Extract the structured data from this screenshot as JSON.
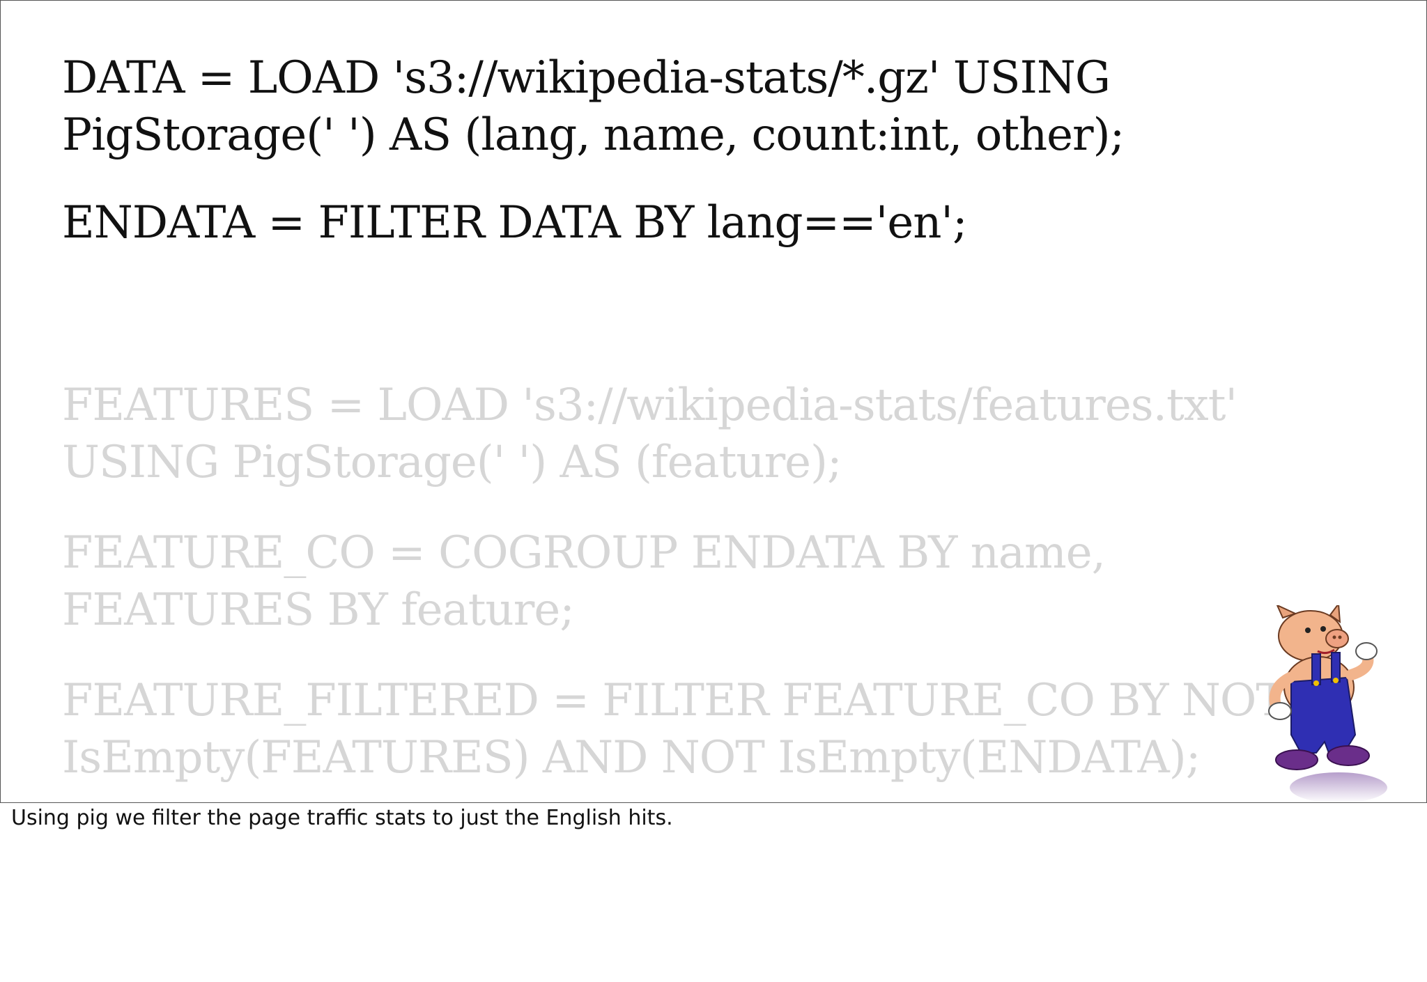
{
  "slide": {
    "lines": [
      {
        "id": "data-load-1",
        "text": "DATA = LOAD 's3://wikipedia-stats/*.gz' USING",
        "state": "active"
      },
      {
        "id": "data-load-2",
        "text": "PigStorage(' ') AS (lang, name, count:int, other);",
        "state": "active"
      },
      {
        "id": "endata-filter",
        "text": "ENDATA = FILTER DATA BY lang=='en';",
        "state": "active"
      },
      {
        "id": "features-load-1",
        "text": "FEATURES = LOAD 's3://wikipedia-stats/features.txt'",
        "state": "faded"
      },
      {
        "id": "features-load-2",
        "text": "USING PigStorage(' ') AS (feature);",
        "state": "faded"
      },
      {
        "id": "feature-co-1",
        "text": "FEATURE_CO = COGROUP ENDATA BY name,",
        "state": "faded"
      },
      {
        "id": "feature-co-2",
        "text": "FEATURES BY feature;",
        "state": "faded"
      },
      {
        "id": "feature-filtered-1",
        "text": "FEATURE_FILTERED = FILTER FEATURE_CO BY NOT",
        "state": "faded"
      },
      {
        "id": "feature-filtered-2",
        "text": "IsEmpty(FEATURES) AND NOT IsEmpty(ENDATA);",
        "state": "faded"
      }
    ],
    "mascot": {
      "icon": "pig-mascot-icon"
    },
    "colors": {
      "active_text": "#111111",
      "faded_text": "#d6d6d6"
    }
  },
  "notes": {
    "text": "Using pig we filter the page traffic stats to just the English hits."
  }
}
